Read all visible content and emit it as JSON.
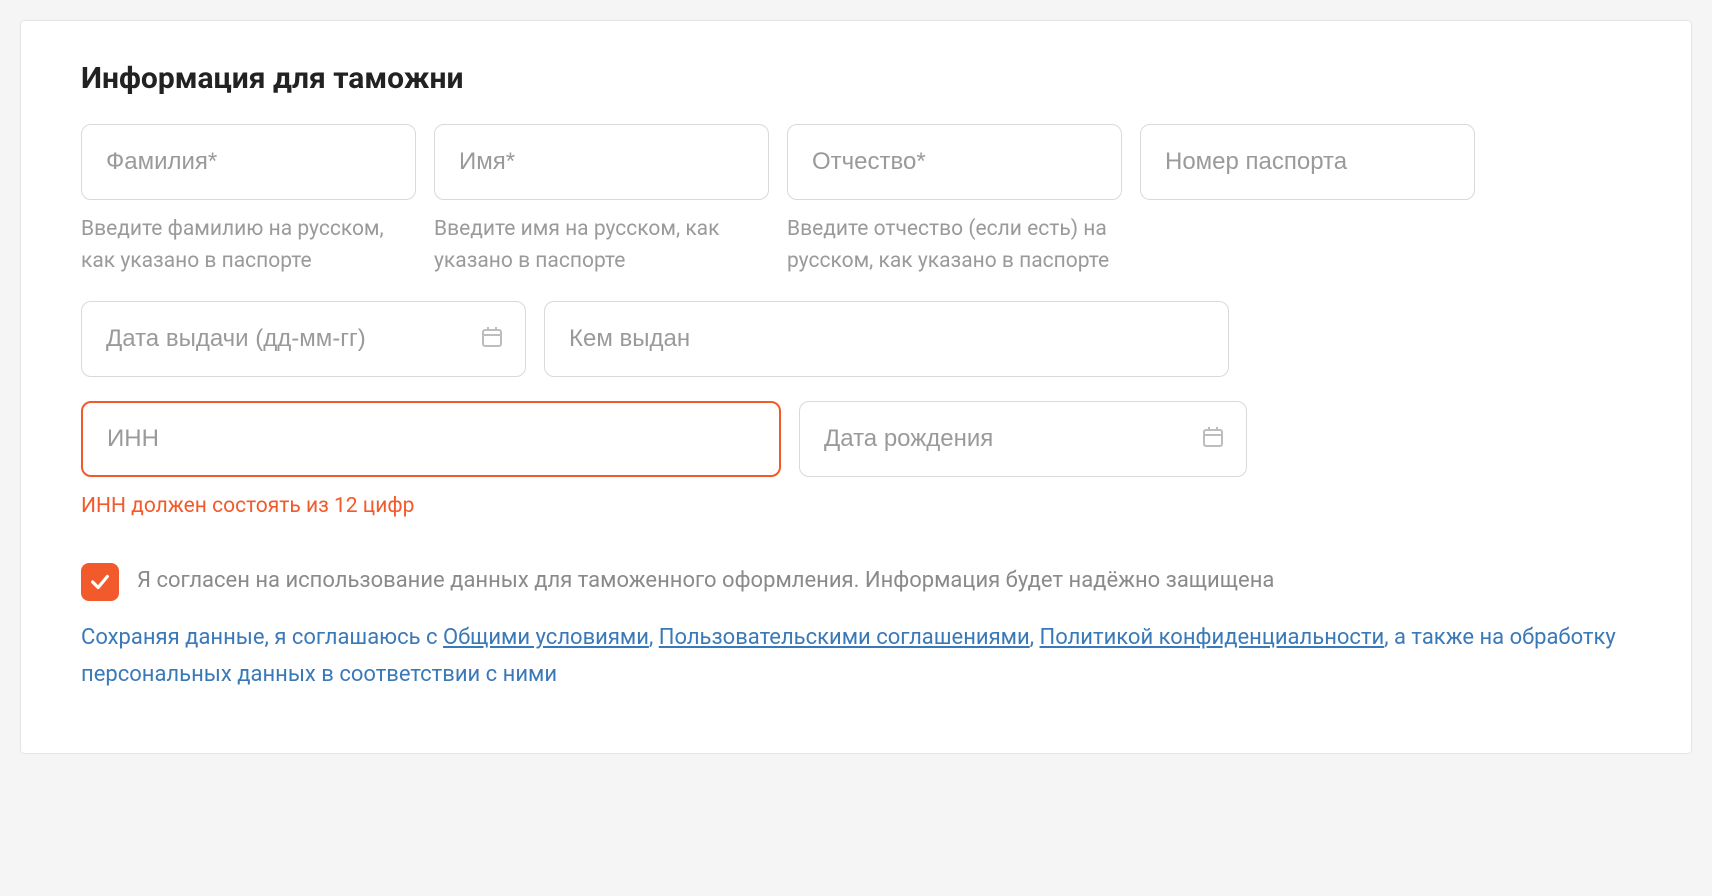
{
  "section_title": "Информация для таможни",
  "fields": {
    "surname": {
      "placeholder": "Фамилия*",
      "hint": "Введите фамилию на русском, как указано в паспорте"
    },
    "name": {
      "placeholder": "Имя*",
      "hint": "Введите имя на русском, как указано в паспорте"
    },
    "patronymic": {
      "placeholder": "Отчество*",
      "hint": "Введите отчество (если есть) на русском, как указано в паспорте"
    },
    "passport_number": {
      "placeholder": "Номер паспорта"
    },
    "issue_date": {
      "placeholder": "Дата выдачи (дд-мм-гг)"
    },
    "issued_by": {
      "placeholder": "Кем выдан"
    },
    "inn": {
      "placeholder": "ИНН",
      "error": "ИНН должен состоять из 12 цифр"
    },
    "birth_date": {
      "placeholder": "Дата рождения"
    }
  },
  "consent": {
    "checked": true,
    "label": "Я согласен на использование данных для таможенного оформления. Информация будет надёжно защищена"
  },
  "legal": {
    "prefix": "Сохраняя данные, я соглашаюсь с ",
    "link1": "Общими условиями",
    "sep1": ", ",
    "link2": "Пользовательскими соглашениями",
    "sep2": ", ",
    "link3": "Политикой конфиденциальности",
    "suffix": ", а также на обработку персональных данных в соответствии с ними"
  }
}
